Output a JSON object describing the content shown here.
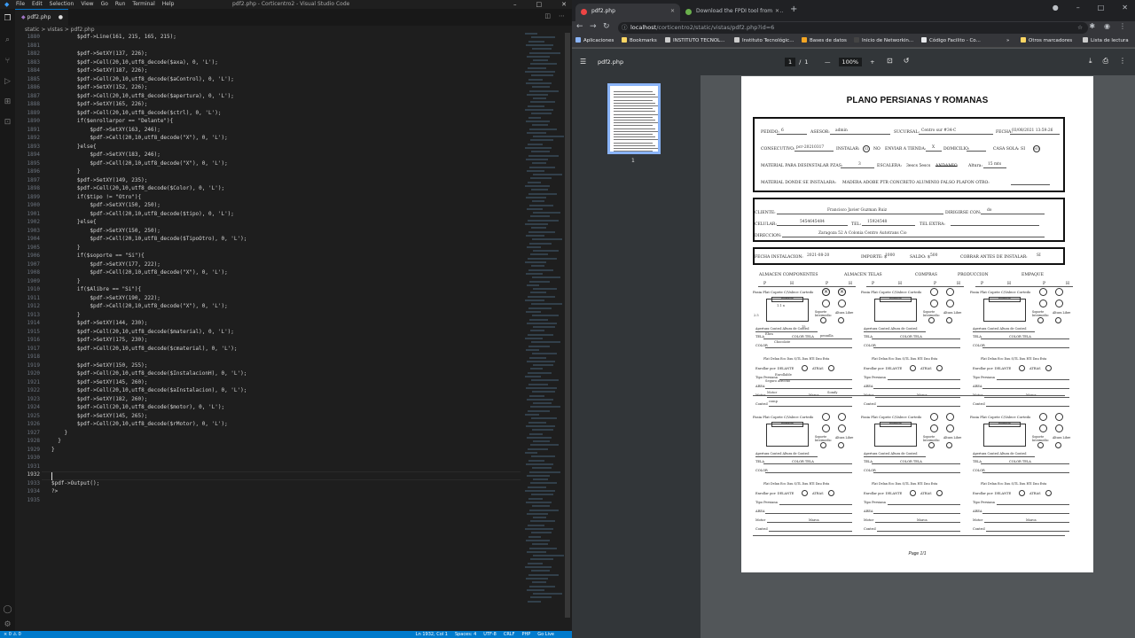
{
  "vscode": {
    "menu": [
      "File",
      "Edit",
      "Selection",
      "View",
      "Go",
      "Run",
      "Terminal",
      "Help"
    ],
    "window_title": "pdf2.php - Corticentro2 - Visual Studio Code",
    "tab_label": "pdf2.php",
    "breadcrumb": "static > vistas > pdf2.php",
    "line_numbers": [
      "1880",
      "1881",
      "1882",
      "1883",
      "1884",
      "1885",
      "1886",
      "1887",
      "1888",
      "1889",
      "1890",
      "1891",
      "1892",
      "1893",
      "1894",
      "1895",
      "1896",
      "1897",
      "1898",
      "1899",
      "1900",
      "1901",
      "1902",
      "1903",
      "1904",
      "1905",
      "1906",
      "1907",
      "1908",
      "1909",
      "1910",
      "1911",
      "1912",
      "1913",
      "1914",
      "1915",
      "1916",
      "1917",
      "1918",
      "1919",
      "1920",
      "1921",
      "1922",
      "1923",
      "1924",
      "1925",
      "1926",
      "1927",
      "1928",
      "1929",
      "1930",
      "1931",
      "1932",
      "1933",
      "1934",
      "1935"
    ],
    "code_lines": [
      "        $pdf->Line(161, 215, 165, 215);",
      "",
      "        $pdf->SetXY(137, 226);",
      "        $pdf->Cell(20,10,utf8_decode($axa), 0, 'L');",
      "        $pdf->SetXY(187, 226);",
      "        $pdf->Cell(20,10,utf8_decode($aControl), 0, 'L');",
      "        $pdf->SetXY(152, 226);",
      "        $pdf->Cell(20,10,utf8_decode($apertura), 0, 'L');",
      "        $pdf->SetXY(165, 226);",
      "        $pdf->Cell(20,10,utf8_decode($ctrl), 0, 'L');",
      "        if($enrollarpor == \"Delante\"){",
      "            $pdf->SetXY(163, 246);",
      "            $pdf->Cell(20,10,utf8_decode(\"X\"), 0, 'L');",
      "        }else{",
      "            $pdf->SetXY(183, 246);",
      "            $pdf->Cell(20,10,utf8_decode(\"X\"), 0, 'L');",
      "        }",
      "        $pdf->SetXY(149, 235);",
      "        $pdf->Cell(20,10,utf8_decode($Color), 0, 'L');",
      "        if($tipo != \"Otro\"){",
      "            $pdf->SetXY(150, 250);",
      "            $pdf->Cell(20,10,utf8_decode($tipo), 0, 'L');",
      "        }else{",
      "            $pdf->SetXY(150, 250);",
      "            $pdf->Cell(20,10,utf8_decode($TipoOtro), 0, 'L');",
      "        }",
      "        if($soporte == \"Si\"){",
      "            $pdf->SetXY(177, 222);",
      "            $pdf->Cell(20,10,utf8_decode(\"X\"), 0, 'L');",
      "        }",
      "        if($Alibre == \"Si\"){",
      "            $pdf->SetXY(190, 222);",
      "            $pdf->Cell(20,10,utf8_decode(\"X\"), 0, 'L');",
      "        }",
      "        $pdf->SetXY(144, 230);",
      "        $pdf->Cell(20,10,utf8_decode($material), 0, 'L');",
      "        $pdf->SetXY(175, 230);",
      "        $pdf->Cell(20,10,utf8_decode($cmaterial), 0, 'L');",
      "",
      "        $pdf->SetXY(150, 255);",
      "        $pdf->Cell(20,10,utf8_decode($InstalacionH), 0, 'L');",
      "        $pdf->SetXY(145, 260);",
      "        $pdf->Cell(20,10,utf8_decode($aInstalacion), 0, 'L');",
      "        $pdf->SetXY(182, 260);",
      "        $pdf->Cell(20,10,utf8_decode($motor), 0, 'L');",
      "        $pdf->SetXY(145, 265);",
      "        $pdf->Cell(20,10,utf8_decode($rMotor), 0, 'L');",
      "    }",
      "  }",
      "}",
      "",
      "",
      "",
      "$pdf->Output();",
      "?>"
    ],
    "status_items": [
      "Ln 1932, Col 1",
      "Spaces: 4",
      "UTF-8",
      "CRLF",
      "PHP",
      "Go Live"
    ]
  },
  "chrome": {
    "tabs": [
      {
        "label": "pdf2.php"
      },
      {
        "label": "Download the FPDI tool from D..."
      }
    ],
    "url_host": "localhost",
    "url_path": "/corticentro2/static/vistas/pdf2.php?id=6",
    "bookmarks": [
      "Aplicaciones",
      "Bookmarks",
      "INSTITUTO TECNOL...",
      "Instituto Tecnológic...",
      "Bases de datos",
      "Inicio de Networkin...",
      "Código Facilito - Co...",
      "»",
      "Otros marcadores",
      "Lista de lectura"
    ],
    "pdf_toolbar": {
      "name": "pdf2.php",
      "page": "1",
      "sep": "/",
      "total": "1",
      "zoom": "100%"
    },
    "thumb_label": "1"
  },
  "pdf": {
    "title": "PLANO PERSIANAS Y ROMANAS",
    "header": {
      "pedido_label": "PEDIDO:",
      "pedido": "6",
      "asesor_label": "ASESOR:",
      "asesor": "admin",
      "sucursal_label": "SUCURSAL:",
      "sucursal": "Centro sur #34-C",
      "fecha_label": "FECHA:",
      "fecha": "03/08/2021 13:59:26",
      "consecutivo_label": "CONSECUTIVO:",
      "consecutivo": "pcr-20210317",
      "instalar_label": "INSTALAR:",
      "instalar": "SI",
      "no_label": "NO",
      "enviar_label": "ENVIAR A TIENDA:",
      "enviar": "X",
      "domicilio_label": "DOMICILIO:",
      "casa_sola_label": "CASA SOLA: SI",
      "casa_sola": "NO",
      "desinstalar_label": "MATERIAL PARA DESINSTALAR PZAS:",
      "desinstalar": "3",
      "escalera_label": "ESCALERA:",
      "escalera_opts": "3escs   5escs",
      "andamio": "ANDAMIO",
      "altura_label": "Altura:",
      "altura": "15 mts",
      "material_label": "MATERIAL DONDE SE INSTALARA:",
      "materiales": "MADERA   ADOBE   PTR   CONCRETO   ALUMINIO   FALSO PLAFON   OTRO:"
    },
    "cliente": {
      "cliente_label": "CLIENTE:",
      "cliente": "Francisco Javier Guzman  Ruiz",
      "dirigirse_label": "DIRIGIRSE CON:",
      "dirigirse": "do",
      "celular_label": "CELULAR:",
      "celular": "5454645484",
      "tel_label": "TEL:",
      "tel": "15924548",
      "tel_extra_label": "TEL EXTRA:",
      "direccion_label": "DIRECCION:",
      "direccion": "Zaragoza 52 A Colonia Centro Autotrans Cio"
    },
    "pago": {
      "fecha_inst_label": "FECHA INSTALACION:",
      "fecha_inst": "2021-08-20",
      "importe_label": "IMPORTE: $",
      "importe": "1000",
      "saldo_label": "SALDO: $",
      "saldo": "500",
      "cobrar_label": "COBRAR ANTES DE INSTALAR:",
      "cobrar": "SI"
    },
    "stages": [
      "ALMACEN COMPONENTES",
      "ALMACEN TELAS",
      "COMPRAS",
      "PRODUCCION",
      "EMPAQUE"
    ],
    "ph": [
      "P",
      "H"
    ],
    "block": {
      "types": "Fasia   Flat   Copete   C/Valece   Cortedo",
      "bar": "Fortada",
      "soporte": "Soporte Intermedio",
      "altura_libre": "Altura Libre",
      "row_apertura": "Apertura      Control      Altura de Control",
      "tela": "TELA",
      "color_tela": "COLOR TELA",
      "color": "COLOR",
      "tipos2": "Flat    Delan   Eco    Dau S/TL    Dau RTI    Dau Esta",
      "enrollar": "Enrollar por: DELANTE",
      "atras": "ATRAS",
      "tipo_persiana": "Tipo Persiana",
      "area": "AREA",
      "motor": "Motor",
      "marca": "Marca",
      "control": "Control"
    },
    "filled": {
      "color1": "Chocolate",
      "tela1": "Ebra",
      "color_tela1": "pennilla",
      "tipo_persiana1": "Enrollable",
      "area1": "Seguro afrocho",
      "motor1": "Motor",
      "marca1": "Somfy",
      "control1": "comp",
      "medida1": "1.1 x",
      "apertura1": "2.5",
      "control_val1": "15"
    },
    "footer": "Page 1/1"
  }
}
